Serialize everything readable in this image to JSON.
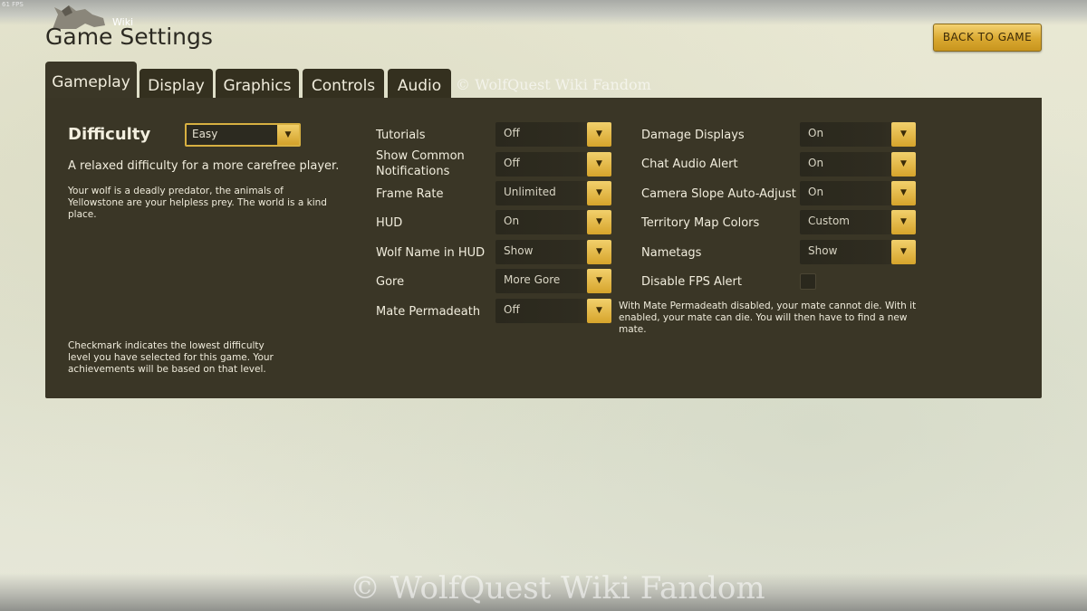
{
  "fps": "61 FPS",
  "logo": {
    "label": "Wiki"
  },
  "title": "Game Settings",
  "back_button": "BACK TO GAME",
  "tabs": [
    "Gameplay",
    "Display",
    "Graphics",
    "Controls",
    "Audio"
  ],
  "active_tab": "Gameplay",
  "watermark_small": "© WolfQuest Wiki Fandom",
  "watermark_big": "© WolfQuest Wiki Fandom",
  "difficulty": {
    "label": "Difficulty",
    "value": "Easy",
    "short_desc": "A relaxed difficulty for a more carefree player.",
    "long_desc": "Your wolf is a deadly predator, the animals of Yellowstone are your helpless prey. The world is a kind place.",
    "note": "Checkmark indicates the lowest difficulty level you have selected for this game. Your achievements will be based on that level."
  },
  "middle_settings": [
    {
      "label": "Tutorials",
      "value": "Off"
    },
    {
      "label": "Show Common Notifications",
      "value": "Off"
    },
    {
      "label": "Frame Rate",
      "value": "Unlimited"
    },
    {
      "label": "HUD",
      "value": "On"
    },
    {
      "label": "Wolf Name in HUD",
      "value": "Show"
    },
    {
      "label": "Gore",
      "value": "More Gore"
    },
    {
      "label": "Mate Permadeath",
      "value": "Off"
    }
  ],
  "right_settings": [
    {
      "label": "Damage Displays",
      "value": "On"
    },
    {
      "label": "Chat Audio Alert",
      "value": "On"
    },
    {
      "label": "Camera Slope Auto-Adjust",
      "value": "On"
    },
    {
      "label": "Territory Map Colors",
      "value": "Custom"
    },
    {
      "label": "Nametags",
      "value": "Show"
    }
  ],
  "fps_alert": {
    "label": "Disable FPS Alert",
    "checked": false
  },
  "mate_note": "With Mate Permadeath disabled, your mate cannot die. With it enabled, your mate can die. You will then have to find a new mate.",
  "icons": {
    "dropdown": "chevron-down-icon"
  },
  "colors": {
    "panel": "#3a3626",
    "accent": "#d9a830",
    "background": "#e6e6d2"
  }
}
